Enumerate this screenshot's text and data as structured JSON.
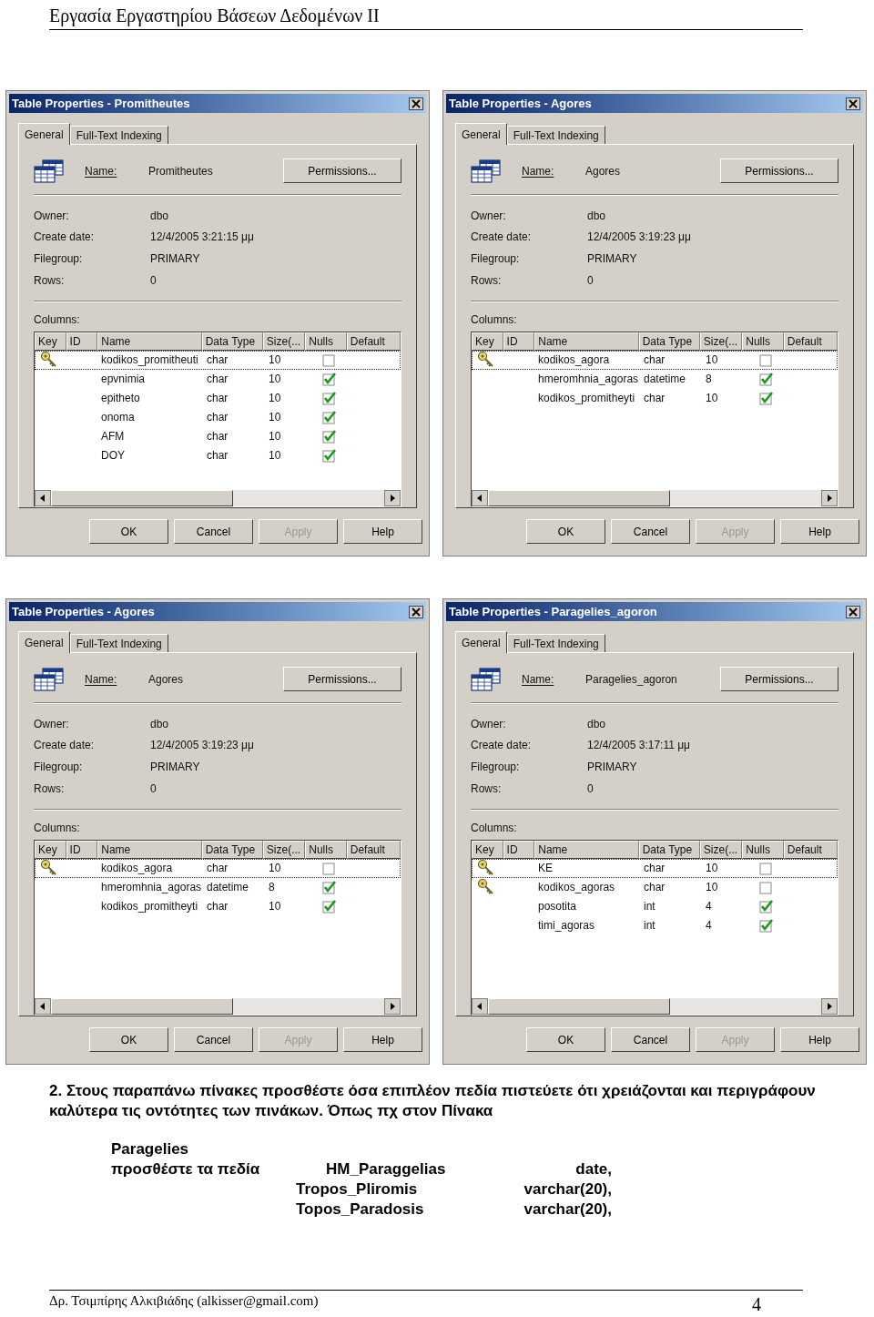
{
  "header": {
    "title": "Εργασία Εργαστηρίου Βάσεων Δεδομένων ΙΙ"
  },
  "dialogs": [
    {
      "title": "Table Properties - Promitheutes",
      "tabs": [
        {
          "label": "General",
          "selected": true
        },
        {
          "label": "Full-Text Indexing",
          "selected": false
        }
      ],
      "name_label": "Name:",
      "name": "Promitheutes",
      "permissions": "Permissions...",
      "properties": [
        {
          "label": "Owner:",
          "value": "dbo"
        },
        {
          "label": "Create date:",
          "value": "12/4/2005 3:21:15 μμ"
        },
        {
          "label": "Filegroup:",
          "value": "PRIMARY"
        },
        {
          "label": "Rows:",
          "value": "0"
        }
      ],
      "columns_label": "Columns:",
      "columns": [
        "Key",
        "ID",
        "Name",
        "Data Type",
        "Size(...",
        "Nulls",
        "Default"
      ],
      "rows": [
        {
          "key": true,
          "name": "kodikos_promitheuti",
          "data_type": "char",
          "size": "10",
          "nulls": false,
          "selected": true
        },
        {
          "key": false,
          "name": "epvnimia",
          "data_type": "char",
          "size": "10",
          "nulls": true,
          "selected": false
        },
        {
          "key": false,
          "name": "epitheto",
          "data_type": "char",
          "size": "10",
          "nulls": true,
          "selected": false
        },
        {
          "key": false,
          "name": "onoma",
          "data_type": "char",
          "size": "10",
          "nulls": true,
          "selected": false
        },
        {
          "key": false,
          "name": "AFM",
          "data_type": "char",
          "size": "10",
          "nulls": true,
          "selected": false
        },
        {
          "key": false,
          "name": "DOY",
          "data_type": "char",
          "size": "10",
          "nulls": true,
          "selected": false
        }
      ],
      "buttons": [
        {
          "label": "OK",
          "disabled": false
        },
        {
          "label": "Cancel",
          "disabled": false
        },
        {
          "label": "Apply",
          "disabled": true
        },
        {
          "label": "Help",
          "disabled": false
        }
      ]
    },
    {
      "title": "Table Properties - Agores",
      "tabs": [
        {
          "label": "General",
          "selected": true
        },
        {
          "label": "Full-Text Indexing",
          "selected": false
        }
      ],
      "name_label": "Name:",
      "name": "Agores",
      "permissions": "Permissions...",
      "properties": [
        {
          "label": "Owner:",
          "value": "dbo"
        },
        {
          "label": "Create date:",
          "value": "12/4/2005 3:19:23 μμ"
        },
        {
          "label": "Filegroup:",
          "value": "PRIMARY"
        },
        {
          "label": "Rows:",
          "value": "0"
        }
      ],
      "columns_label": "Columns:",
      "columns": [
        "Key",
        "ID",
        "Name",
        "Data Type",
        "Size(...",
        "Nulls",
        "Default"
      ],
      "rows": [
        {
          "key": true,
          "name": "kodikos_agora",
          "data_type": "char",
          "size": "10",
          "nulls": false,
          "selected": true
        },
        {
          "key": false,
          "name": "hmeromhnia_agoras",
          "data_type": "datetime",
          "size": "8",
          "nulls": true,
          "selected": false
        },
        {
          "key": false,
          "name": "kodikos_promitheyti",
          "data_type": "char",
          "size": "10",
          "nulls": true,
          "selected": false
        }
      ],
      "buttons": [
        {
          "label": "OK",
          "disabled": false
        },
        {
          "label": "Cancel",
          "disabled": false
        },
        {
          "label": "Apply",
          "disabled": true
        },
        {
          "label": "Help",
          "disabled": false
        }
      ]
    },
    {
      "title": "Table Properties - Agores",
      "tabs": [
        {
          "label": "General",
          "selected": true
        },
        {
          "label": "Full-Text Indexing",
          "selected": false
        }
      ],
      "name_label": "Name:",
      "name": "Agores",
      "permissions": "Permissions...",
      "properties": [
        {
          "label": "Owner:",
          "value": "dbo"
        },
        {
          "label": "Create date:",
          "value": "12/4/2005 3:19:23 μμ"
        },
        {
          "label": "Filegroup:",
          "value": "PRIMARY"
        },
        {
          "label": "Rows:",
          "value": "0"
        }
      ],
      "columns_label": "Columns:",
      "columns": [
        "Key",
        "ID",
        "Name",
        "Data Type",
        "Size(...",
        "Nulls",
        "Default"
      ],
      "rows": [
        {
          "key": true,
          "name": "kodikos_agora",
          "data_type": "char",
          "size": "10",
          "nulls": false,
          "selected": true
        },
        {
          "key": false,
          "name": "hmeromhnia_agoras",
          "data_type": "datetime",
          "size": "8",
          "nulls": true,
          "selected": false
        },
        {
          "key": false,
          "name": "kodikos_promitheyti",
          "data_type": "char",
          "size": "10",
          "nulls": true,
          "selected": false
        }
      ],
      "buttons": [
        {
          "label": "OK",
          "disabled": false
        },
        {
          "label": "Cancel",
          "disabled": false
        },
        {
          "label": "Apply",
          "disabled": true
        },
        {
          "label": "Help",
          "disabled": false
        }
      ]
    },
    {
      "title": "Table Properties - Paragelies_agoron",
      "tabs": [
        {
          "label": "General",
          "selected": true
        },
        {
          "label": "Full-Text Indexing",
          "selected": false
        }
      ],
      "name_label": "Name:",
      "name": "Paragelies_agoron",
      "permissions": "Permissions...",
      "properties": [
        {
          "label": "Owner:",
          "value": "dbo"
        },
        {
          "label": "Create date:",
          "value": "12/4/2005 3:17:11 μμ"
        },
        {
          "label": "Filegroup:",
          "value": "PRIMARY"
        },
        {
          "label": "Rows:",
          "value": "0"
        }
      ],
      "columns_label": "Columns:",
      "columns": [
        "Key",
        "ID",
        "Name",
        "Data Type",
        "Size(...",
        "Nulls",
        "Default"
      ],
      "rows": [
        {
          "key": true,
          "name": "KE",
          "data_type": "char",
          "size": "10",
          "nulls": false,
          "selected": true
        },
        {
          "key": true,
          "name": "kodikos_agoras",
          "data_type": "char",
          "size": "10",
          "nulls": false,
          "selected": false
        },
        {
          "key": false,
          "name": "posotita",
          "data_type": "int",
          "size": "4",
          "nulls": true,
          "selected": false
        },
        {
          "key": false,
          "name": "timi_agoras",
          "data_type": "int",
          "size": "4",
          "nulls": true,
          "selected": false
        }
      ],
      "buttons": [
        {
          "label": "OK",
          "disabled": false
        },
        {
          "label": "Cancel",
          "disabled": false
        },
        {
          "label": "Apply",
          "disabled": true
        },
        {
          "label": "Help",
          "disabled": false
        }
      ]
    }
  ],
  "instruction": "2. Στους παραπάνω πίνακες προσθέστε όσα επιπλέον πεδία πιστεύετε ότι χρειάζονται και περιγράφουν καλύτερα τις οντότητες των πινάκων. Όπως πχ στον Πίνακα",
  "example": {
    "table": "Paragelies",
    "label": "προσθέστε τα πεδία",
    "fields": [
      {
        "name": "HM_Paraggelias",
        "type": "date,"
      },
      {
        "name": "Tropos_Pliromis",
        "type": "varchar(20),"
      },
      {
        "name": "Topos_Paradosis",
        "type": "varchar(20),"
      }
    ]
  },
  "footer": {
    "author": "Δρ. Τσιμπίρης Αλκιβιάδης (alkisser@gmail.com)",
    "page": "4"
  }
}
